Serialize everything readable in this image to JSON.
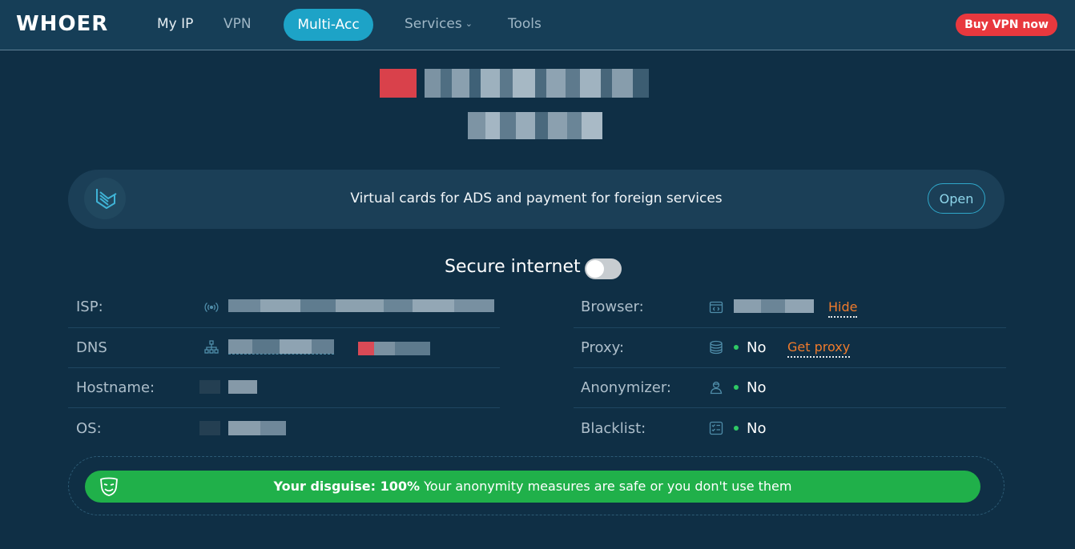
{
  "header": {
    "logo": "WHOER",
    "nav": {
      "my_ip": "My IP",
      "vpn": "VPN",
      "multi_acc": "Multi-Acc",
      "services": "Services",
      "tools": "Tools"
    },
    "buy_button": "Buy VPN now"
  },
  "promo": {
    "text": "Virtual cards for ADS and payment for foreign services",
    "open_button": "Open"
  },
  "secure_internet": {
    "label": "Secure internet",
    "enabled": false
  },
  "left_rows": {
    "isp": {
      "label": "ISP:"
    },
    "dns": {
      "label": "DNS"
    },
    "hostname": {
      "label": "Hostname:"
    },
    "os": {
      "label": "OS:"
    }
  },
  "right_rows": {
    "browser": {
      "label": "Browser:",
      "action": "Hide"
    },
    "proxy": {
      "label": "Proxy:",
      "value": "No",
      "action": "Get proxy"
    },
    "anonymizer": {
      "label": "Anonymizer:",
      "value": "No"
    },
    "blacklist": {
      "label": "Blacklist:",
      "value": "No"
    }
  },
  "disguise": {
    "prefix": "Your disguise: 100%",
    "message": " Your anonymity measures are safe or you don't use them"
  },
  "colors": {
    "background": "#0f2f45",
    "header": "#163e57",
    "accent": "#1da3c7",
    "buy": "#e8383e",
    "orange_link": "#f07b2c",
    "status_green": "#2fca66",
    "disguise_green": "#20b04a"
  }
}
